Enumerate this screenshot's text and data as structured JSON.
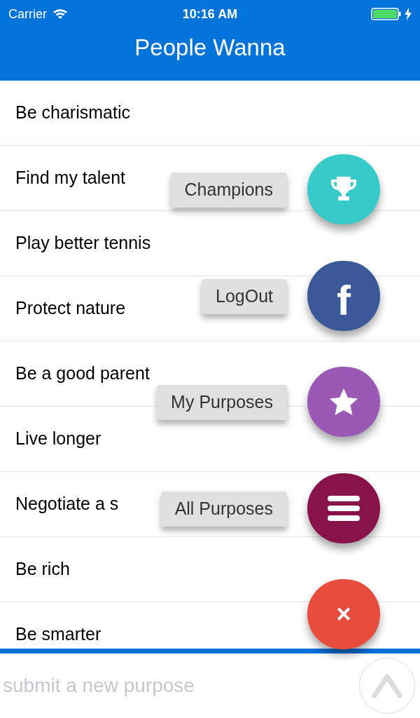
{
  "status_bar": {
    "carrier": "Carrier",
    "time": "10:16 AM"
  },
  "header": {
    "title": "People Wanna"
  },
  "purposes": [
    "Be charismatic",
    "Find my talent",
    "Play better tennis",
    "Protect nature",
    "Be a good parent",
    "Live longer",
    "Negotiate a s",
    "Be rich",
    "Be smarter"
  ],
  "fab_menu": [
    {
      "label": "Champions",
      "kind": "trophy",
      "color": "#36cac9"
    },
    {
      "label": "LogOut",
      "kind": "letter",
      "glyph": "f",
      "color": "#3b5998"
    },
    {
      "label": "My Purposes",
      "kind": "star",
      "color": "#9b59b6"
    },
    {
      "label": "All Purposes",
      "kind": "menu",
      "color": "#88134a"
    }
  ],
  "close_button": {
    "symbol": "×",
    "color": "#e74c3c"
  },
  "input": {
    "placeholder": "submit a new purpose"
  }
}
